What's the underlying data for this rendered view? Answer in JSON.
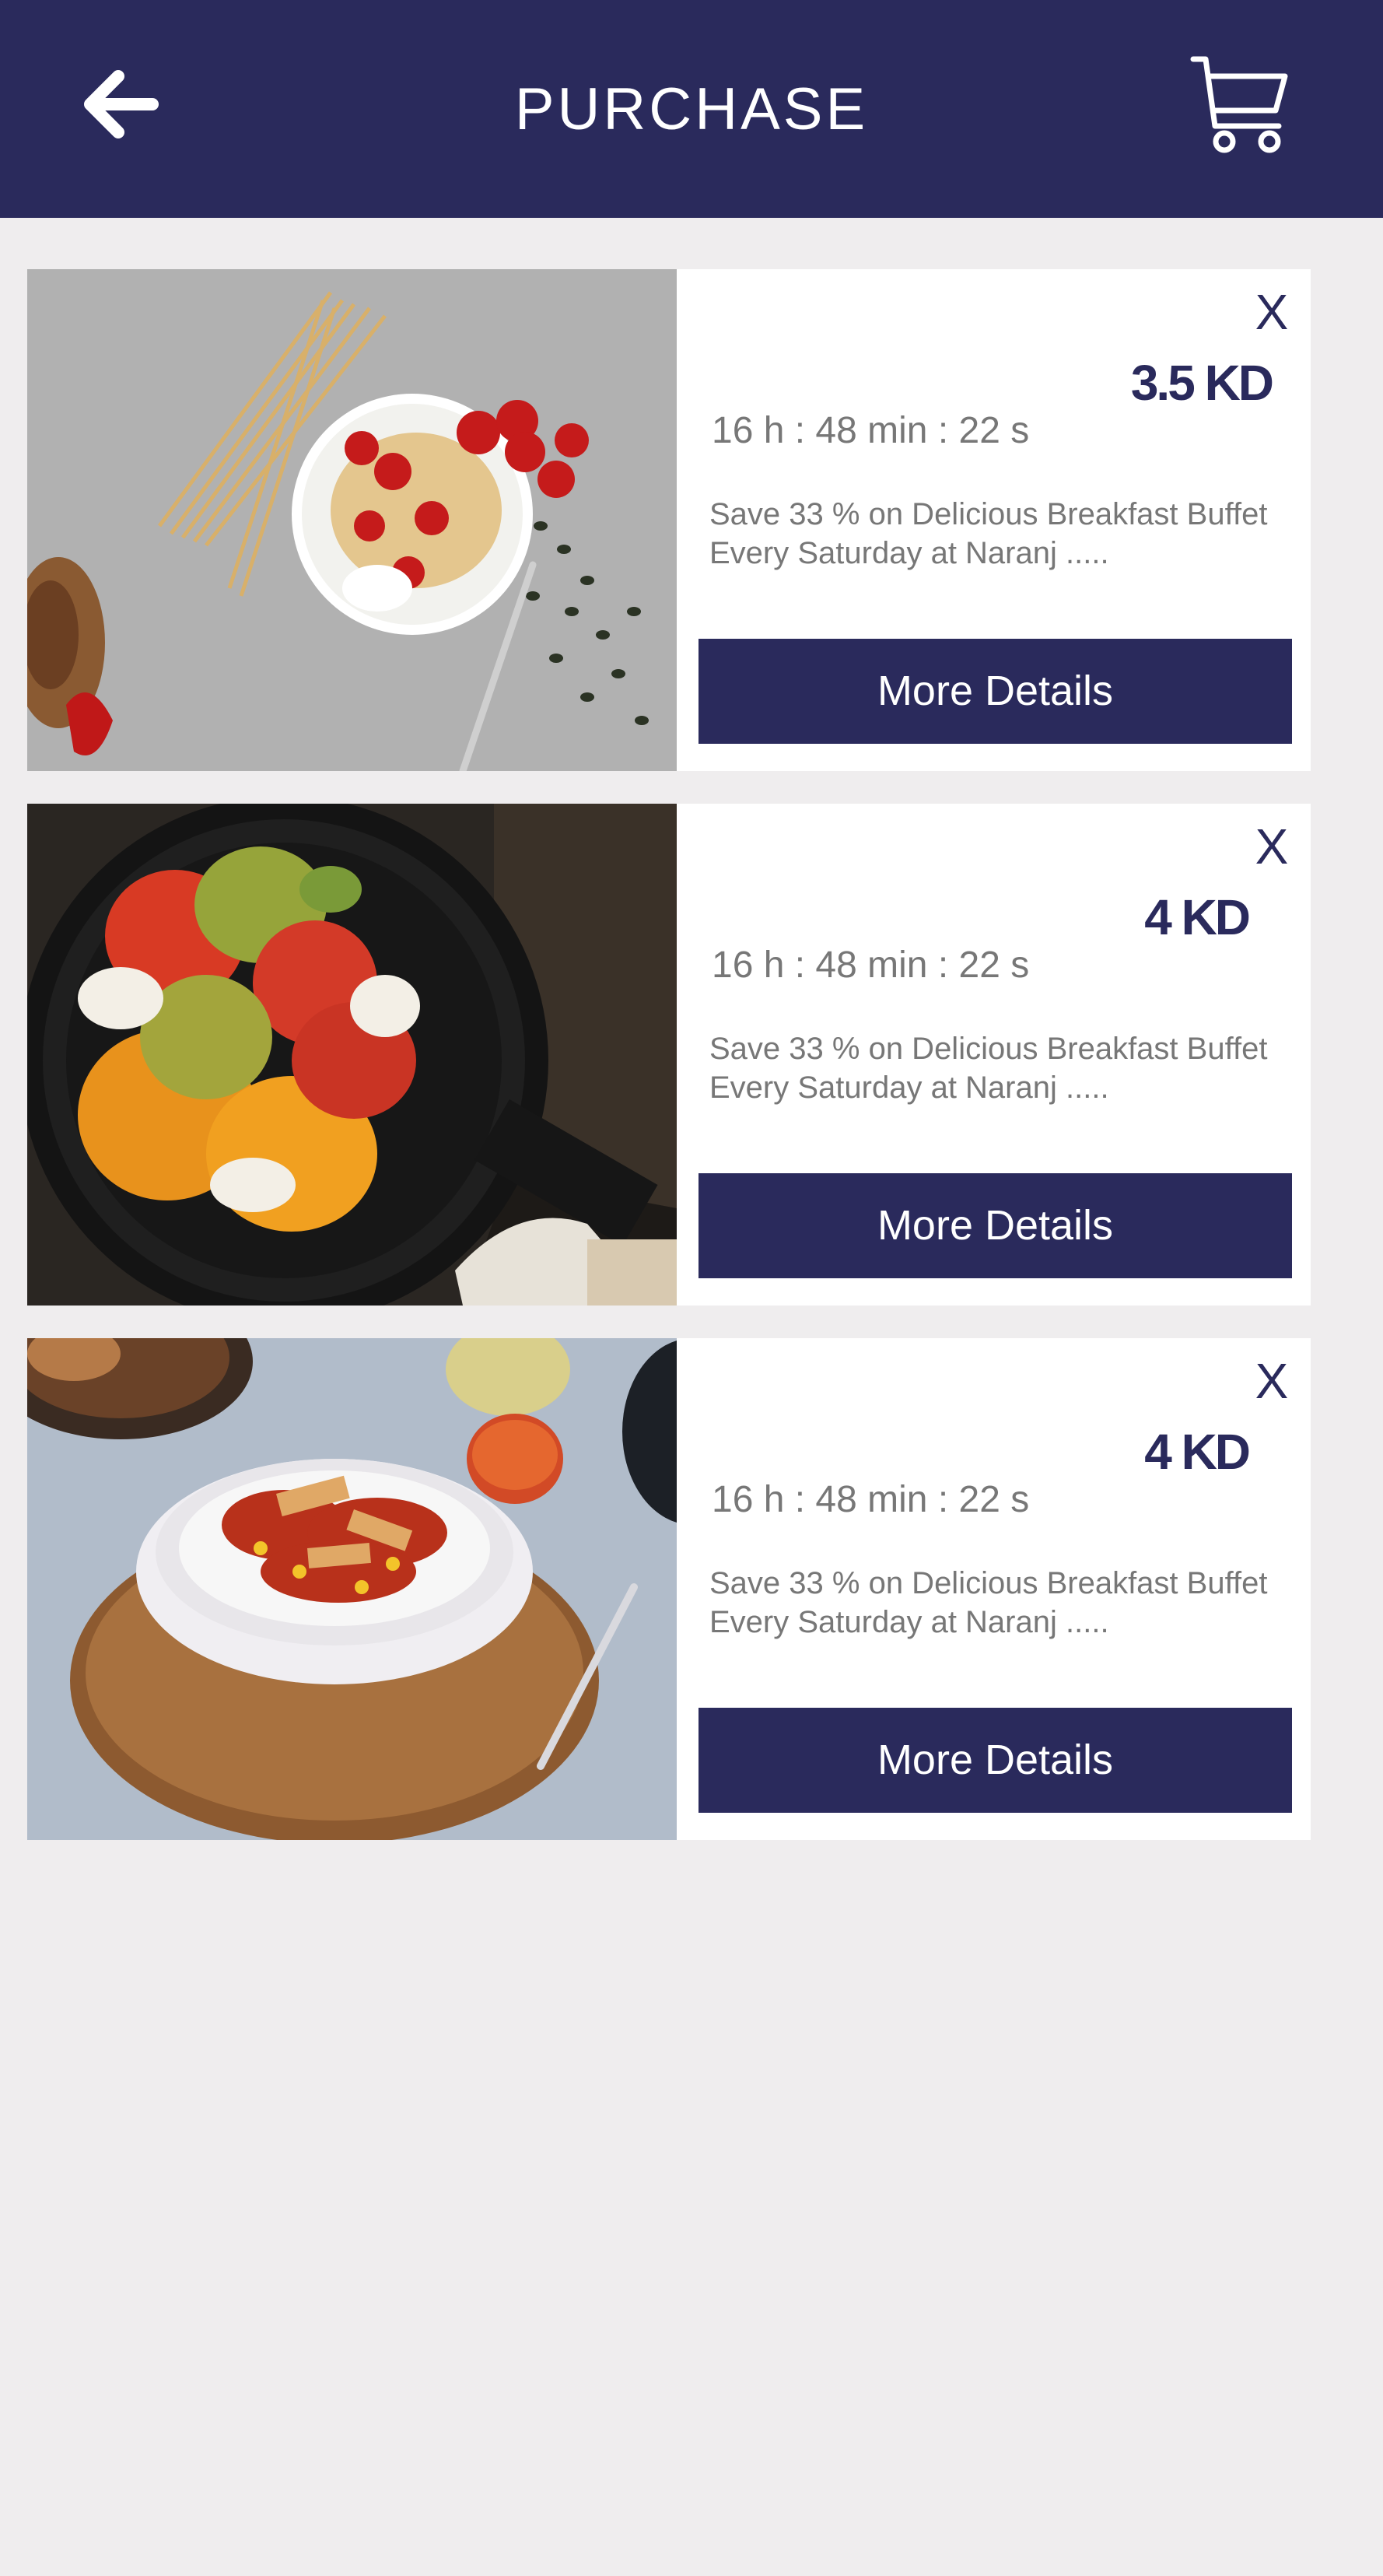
{
  "header": {
    "title": "PURCHASE",
    "back_icon": "arrow-left-icon",
    "cart_icon": "shopping-cart-icon",
    "background_color": "#2a2a5c"
  },
  "deals": [
    {
      "image": "pasta-bowl-with-tomatoes",
      "close_label": "X",
      "price": "3.5 KD",
      "timer": "16 h : 48 min : 22 s",
      "description": "Save 33 % on Delicious Breakfast Buffet Every Saturday at Naranj .....",
      "button_label": "More Details"
    },
    {
      "image": "tomato-salad-in-skillet",
      "close_label": "X",
      "price": "4 KD",
      "timer": "16 h : 48 min : 22 s",
      "description": "Save 33 % on Delicious Breakfast Buffet Every Saturday at Naranj .....",
      "button_label": "More Details"
    },
    {
      "image": "chicken-rice-bowl",
      "close_label": "X",
      "price": "4 KD",
      "timer": "16 h : 48 min : 22 s",
      "description": "Save 33 % on Delicious Breakfast Buffet Every Saturday at Naranj .....",
      "button_label": "More Details"
    }
  ]
}
